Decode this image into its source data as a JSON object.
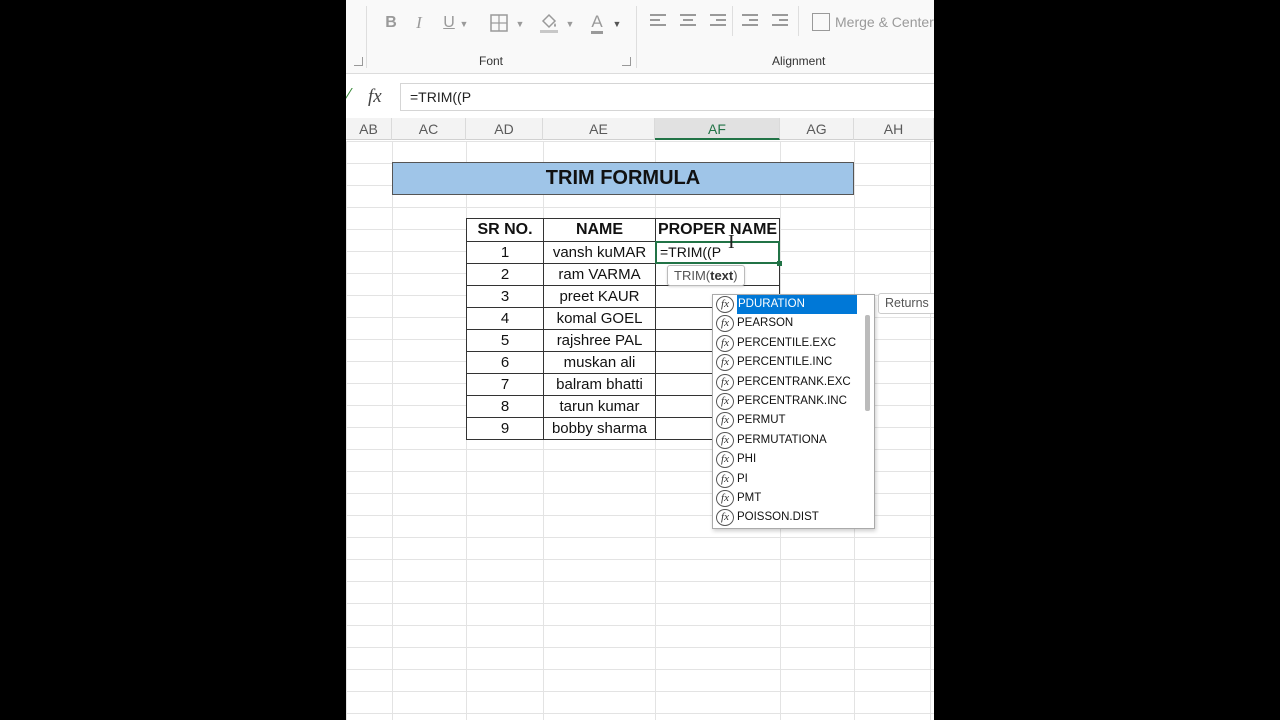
{
  "ribbon": {
    "font_group_label": "Font",
    "alignment_group_label": "Alignment",
    "bold_label": "B",
    "italic_label": "I",
    "underline_label": "U",
    "font_color_glyph": "A",
    "merge_center_label": "Merge & Center"
  },
  "formula_bar": {
    "fx_label": "fx",
    "value": "=TRIM((P"
  },
  "columns": [
    {
      "label": "AB",
      "selected": false
    },
    {
      "label": "AC",
      "selected": false
    },
    {
      "label": "AD",
      "selected": false
    },
    {
      "label": "AE",
      "selected": false
    },
    {
      "label": "AF",
      "selected": true
    },
    {
      "label": "AG",
      "selected": false
    },
    {
      "label": "AH",
      "selected": false
    }
  ],
  "sheet": {
    "title": "TRIM FORMULA",
    "headers": {
      "sr": "SR NO.",
      "name": "NAME",
      "proper": "PROPER NAME"
    },
    "rows": [
      {
        "sr": "1",
        "name": "vansh kuMAR",
        "proper": ""
      },
      {
        "sr": "2",
        "name": "ram VARMA",
        "proper": ""
      },
      {
        "sr": "3",
        "name": "preet KAUR",
        "proper": ""
      },
      {
        "sr": "4",
        "name": "komal GOEL",
        "proper": ""
      },
      {
        "sr": "5",
        "name": "rajshree PAL",
        "proper": ""
      },
      {
        "sr": "6",
        "name": "muskan ali",
        "proper": ""
      },
      {
        "sr": "7",
        "name": "balram bhatti",
        "proper": ""
      },
      {
        "sr": "8",
        "name": "tarun kumar",
        "proper": ""
      },
      {
        "sr": "9",
        "name": "bobby sharma",
        "proper": ""
      }
    ],
    "active_cell_value": "=TRIM((P"
  },
  "tooltip": {
    "function": "TRIM(",
    "arg": "text",
    "close": ")"
  },
  "autocomplete": {
    "items": [
      "PDURATION",
      "PEARSON",
      "PERCENTILE.EXC",
      "PERCENTILE.INC",
      "PERCENTRANK.EXC",
      "PERCENTRANK.INC",
      "PERMUT",
      "PERMUTATIONA",
      "PHI",
      "PI",
      "PMT",
      "POISSON.DIST"
    ],
    "selected_index": 0,
    "icon_label": "fx"
  },
  "returns_label": "Returns",
  "colors": {
    "accent": "#217346",
    "title_fill": "#9fc5e8",
    "selection": "#0078d7"
  }
}
